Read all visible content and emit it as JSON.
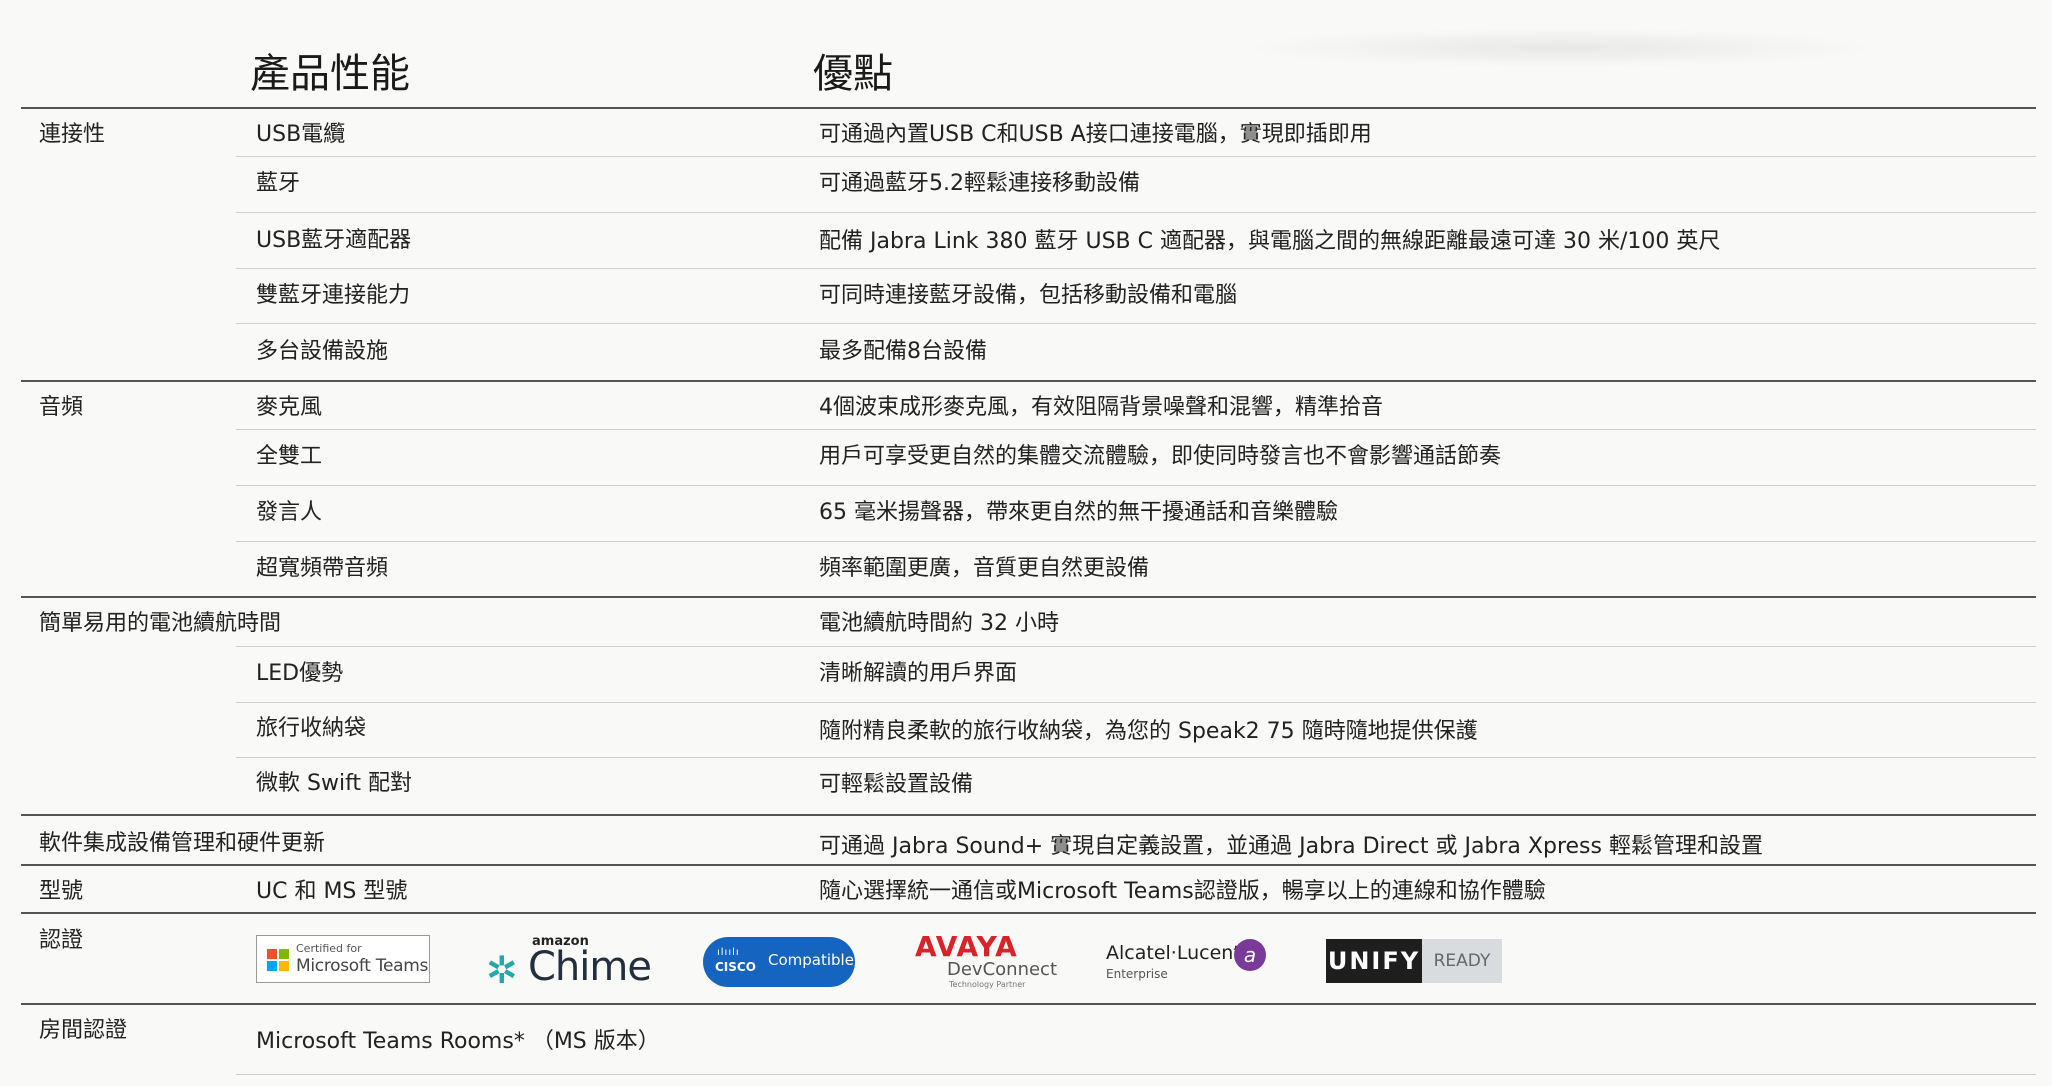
{
  "header": {
    "feature": "產品性能",
    "benefit": "優點"
  },
  "rows": [
    {
      "category": "連接性",
      "feature": "USB電纜",
      "benefit": "可通過內置USB C和USB A接口連接電腦，實現即插即用"
    },
    {
      "category": "",
      "feature": "藍牙",
      "benefit": "可通過藍牙5.2輕鬆連接移動設備"
    },
    {
      "category": "",
      "feature": "USB藍牙適配器",
      "benefit": "配備 Jabra Link 380 藍牙 USB C 適配器，與電腦之間的無線距離最遠可達 30 米/100 英尺"
    },
    {
      "category": "",
      "feature": "雙藍牙連接能力",
      "benefit": "可同時連接藍牙設備，包括移動設備和電腦"
    },
    {
      "category": "",
      "feature": "多台設備設施",
      "benefit": "最多配備8台設備"
    },
    {
      "category": "音頻",
      "feature": "麥克風",
      "benefit": "4個波束成形麥克風，有效阻隔背景噪聲和混響，精準拾音"
    },
    {
      "category": "",
      "feature": "全雙工",
      "benefit": "用戶可享受更自然的集體交流體驗，即使同時發言也不會影響通話節奏"
    },
    {
      "category": "",
      "feature": "發言人",
      "benefit": "65 毫米揚聲器，帶來更自然的無干擾通話和音樂體驗"
    },
    {
      "category": "",
      "feature": "超寬頻帶音頻",
      "benefit": "頻率範圍更廣，音質更自然更設備"
    },
    {
      "category": "簡單易用的電池續航時間",
      "feature": "",
      "benefit": "電池續航時間約 32 小時"
    },
    {
      "category": "",
      "feature": "LED優勢",
      "benefit": "清晰解讀的用戶界面"
    },
    {
      "category": "",
      "feature": "旅行收納袋",
      "benefit": "隨附精良柔軟的旅行收納袋，為您的 Speak2 75 隨時隨地提供保護"
    },
    {
      "category": "",
      "feature": "微軟 Swift 配對",
      "benefit": "可輕鬆設置設備"
    },
    {
      "category": "軟件集成設備管理和硬件更新",
      "feature": "",
      "benefit": "可通過 Jabra Sound+ 實現自定義設置，並通過 Jabra Direct 或 Jabra Xpress 輕鬆管理和設置"
    },
    {
      "category": "型號",
      "feature": "UC 和 MS 型號",
      "benefit": "隨心選擇統一通信或Microsoft Teams認證版，暢享以上的連線和協作體驗"
    }
  ],
  "certification": {
    "label": "認證",
    "logos": {
      "microsoft": {
        "line1": "Certified for",
        "line2": "Microsoft Teams"
      },
      "chime": {
        "top": "amazon",
        "word": "Chime"
      },
      "cisco": {
        "bars": "ılıılı",
        "word": "CISCO",
        "badge": "Compatible"
      },
      "avaya": {
        "word": "AVAYA",
        "sub": "DevConnect",
        "tiny": "Technology Partner"
      },
      "alcatel": {
        "word": "Alcatel·Lucent",
        "sub": "Enterprise",
        "mark": "a"
      },
      "unify": {
        "word": "UNIFY",
        "ready": "READY"
      }
    },
    "colors": {
      "avaya": "#d8232a",
      "cisco": "#1565c0",
      "chime": "#22a9a9",
      "alcatel": "#7a3a9a",
      "unify": "#1e1e1e"
    }
  },
  "room_cert": {
    "label": "房間認證",
    "value": "Microsoft Teams Rooms* （MS 版本）"
  }
}
